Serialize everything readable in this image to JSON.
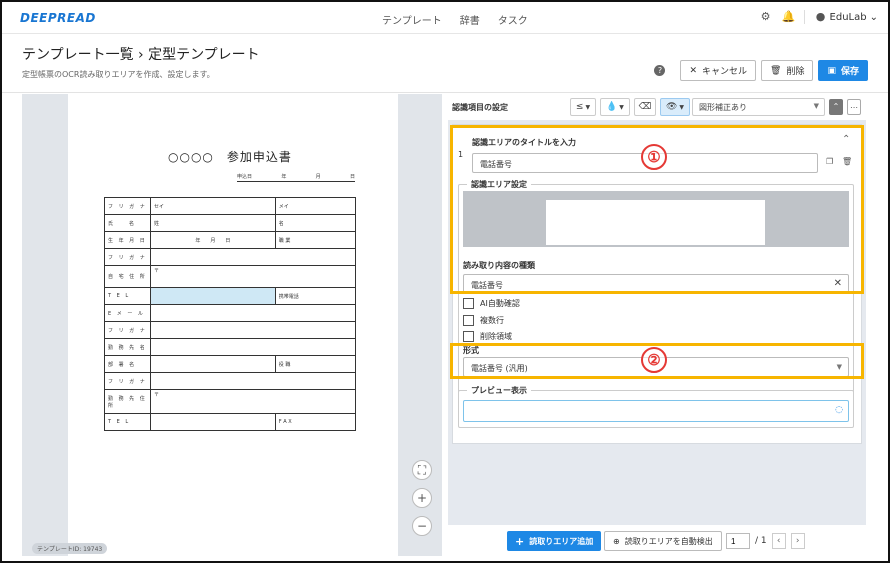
{
  "app": {
    "logo": "DEEPREAD"
  },
  "nav": [
    "テンプレート",
    "辞書",
    "タスク"
  ],
  "user": {
    "name": "EduLab"
  },
  "header": {
    "title": "テンプレート一覧 › 定型テンプレート",
    "subtitle": "定型帳票のOCR読み取りエリアを作成、設定します。",
    "cancel_label": "キャンセル",
    "delete_label": "削除",
    "save_label": "保存"
  },
  "document": {
    "title": "○○○○　参加申込書",
    "date_label": "申込日",
    "date_parts": [
      "年",
      "月",
      "日"
    ],
    "rows": [
      [
        "フ リ ガ ナ",
        "セイ",
        "メイ"
      ],
      [
        "氏　　名",
        "姓",
        "名"
      ],
      [
        "生 年 月 日",
        "年　　月　　日",
        "職 業"
      ],
      [
        "フ リ ガ ナ",
        "",
        ""
      ],
      [
        "自 宅 住 所",
        "〒",
        ""
      ],
      [
        "T E L",
        "",
        "携帯電話"
      ],
      [
        "E メ ー ル",
        "",
        ""
      ],
      [
        "フ リ ガ ナ",
        "",
        ""
      ],
      [
        "勤 務 先 名",
        "",
        ""
      ],
      [
        "部 署 名",
        "",
        "役 職"
      ],
      [
        "フ リ ガ ナ",
        "",
        ""
      ],
      [
        "勤 務 先 住 所",
        "〒",
        ""
      ],
      [
        "T E L",
        "",
        "F A X"
      ]
    ],
    "template_id": "テンプレートID: 19743"
  },
  "settings": {
    "title": "認識項目の設定",
    "toolbar": {
      "le_symbol": "≤",
      "correction_select": "図形補正あり"
    },
    "item_number": "1",
    "area_title_label": "認識エリアのタイトルを入力",
    "area_title_value": "電話番号",
    "area_settings_label": "認識エリア設定",
    "content_type_label": "読み取り内容の種類",
    "content_type_value": "電話番号",
    "checkboxes": [
      "AI自動確認",
      "複数行",
      "削除領域"
    ],
    "format_label": "形式",
    "format_value": "電話番号 (汎用)",
    "preview_label": "プレビュー表示",
    "annotation_1": "①",
    "annotation_2": "②"
  },
  "footer": {
    "add_area_label": "読取りエリア追加",
    "auto_detect_label": "読取りエリアを自動検出",
    "page_current": "1",
    "page_total": "/ 1"
  },
  "colors": {
    "accent": "#1e88e5",
    "highlight": "#f7b500",
    "annotation": "#e53935"
  }
}
